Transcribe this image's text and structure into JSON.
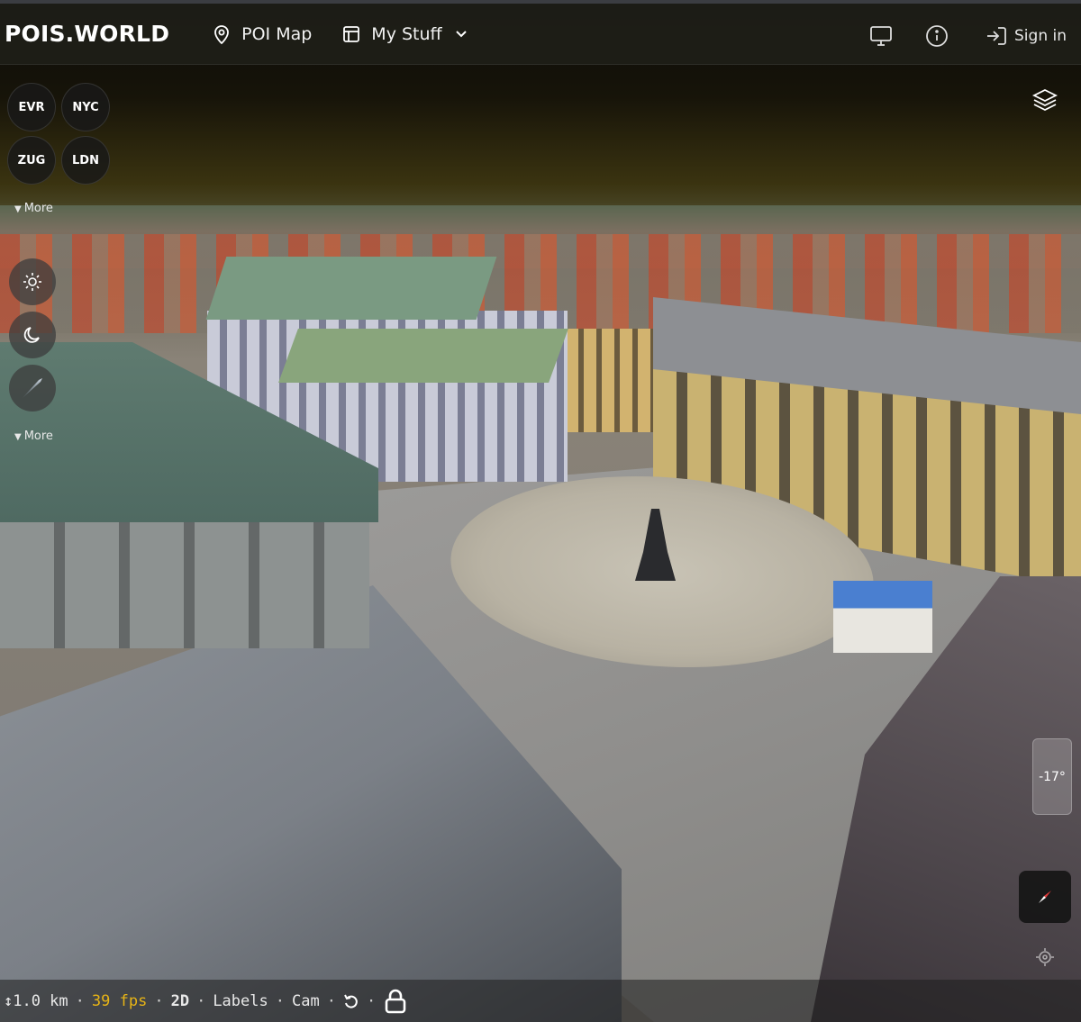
{
  "app": {
    "brand": "POIS.WORLD"
  },
  "nav": {
    "poi_map": {
      "label": "POI Map",
      "icon": "map-pin-icon"
    },
    "my_stuff": {
      "label": "My Stuff",
      "icon": "layout-icon"
    }
  },
  "header_right": {
    "display_icon": "monitor-icon",
    "info_icon": "info-icon",
    "sign_in": "Sign in"
  },
  "cities": [
    "EVR",
    "NYC",
    "ZUG",
    "LDN"
  ],
  "more_cities": "More",
  "more_times": "More",
  "time_of_day": [
    "sun-icon",
    "moon-icon",
    "comet-icon"
  ],
  "tilt_readout": "-17°",
  "status": {
    "distance": "↕1.0 km",
    "fps": "39 fps",
    "mode": "2D",
    "labels": "Labels",
    "cam": "Cam"
  },
  "colors": {
    "accent_fps": "#e7b416",
    "toolbar_bg": "#1e1e18"
  }
}
